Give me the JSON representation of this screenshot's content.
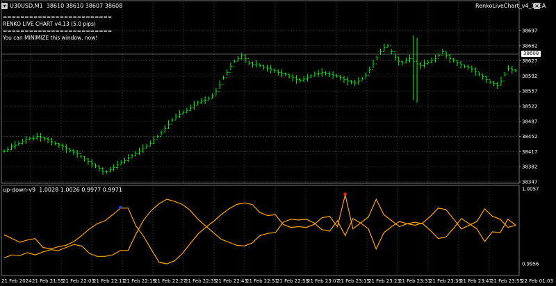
{
  "main_chart": {
    "title": "U30USD,M1  38610 38610 38607 38608",
    "indicator_name": "RenkoLiveChart_v4_13EA",
    "current_price": "38608",
    "renko_info": {
      "line1": "=========================",
      "line2": "RENKO LIVE CHART v4.13 (5.0 pips)",
      "line3": "=========================",
      "line4": "You can MINIMIZE this window, now!"
    },
    "price_ticks": [
      "38697",
      "38662",
      "38627",
      "38592",
      "38557",
      "38522",
      "38487",
      "38452",
      "38417",
      "38382",
      "38347"
    ],
    "colors": {
      "bars": "#00ff00",
      "grid": "#3c3c3c",
      "background": "#000000",
      "price_line": "#808080"
    }
  },
  "sub_chart": {
    "title": "up-down-v9  1.0028 1.0026 0.9977 0.9971",
    "ticks": [
      "1.0057",
      "0.9956"
    ],
    "colors": {
      "lines": "#ffa500",
      "dot_blue": "#2040ff",
      "dot_red": "#ff2020"
    }
  },
  "time_axis": [
    "21 Feb 2024",
    "21 Feb 21:55",
    "21 Feb 22:03",
    "21 Feb 22:11",
    "21 Feb 22:19",
    "21 Feb 22:27",
    "21 Feb 22:35",
    "21 Feb 22:43",
    "21 Feb 22:51",
    "21 Feb 22:59",
    "21 Feb 23:07",
    "21 Feb 23:15",
    "21 Feb 23:23",
    "21 Feb 23:31",
    "21 Feb 23:39",
    "21 Feb 23:47",
    "21 Feb 23:55",
    "22 Feb 01:03"
  ],
  "window_controls": {
    "menu_icon": "chevron-down-icon",
    "close_icon": "close-icon"
  },
  "chart_data": {
    "type": "line",
    "price_series": [
      38418,
      38422,
      38428,
      38432,
      38436,
      38440,
      38444,
      38447,
      38448,
      38452,
      38450,
      38447,
      38444,
      38440,
      38436,
      38432,
      38428,
      38424,
      38420,
      38416,
      38412,
      38406,
      38400,
      38394,
      38390,
      38384,
      38378,
      38372,
      38370,
      38375,
      38380,
      38386,
      38392,
      38396,
      38402,
      38408,
      38412,
      38418,
      38424,
      38430,
      38436,
      38444,
      38452,
      38460,
      38470,
      38480,
      38490,
      38498,
      38504,
      38508,
      38512,
      38518,
      38524,
      38530,
      38534,
      38536,
      38540,
      38546,
      38556,
      38572,
      38588,
      38600,
      38614,
      38626,
      38632,
      38638,
      38632,
      38622,
      38618,
      38620,
      38616,
      38612,
      38610,
      38608,
      38604,
      38600,
      38598,
      38596,
      38592,
      38588,
      38584,
      38582,
      38585,
      38588,
      38592,
      38596,
      38598,
      38600,
      38598,
      38596,
      38594,
      38592,
      38588,
      38584,
      38580,
      38578,
      38576,
      38580,
      38586,
      38594,
      38606,
      38620,
      38634,
      38648,
      38658,
      38662,
      38648,
      38636,
      38626,
      38622,
      38628,
      38632,
      38626,
      38620,
      38616,
      38620,
      38624,
      38628,
      38632,
      38640,
      38648,
      38640,
      38632,
      38628,
      38622,
      38618,
      38614,
      38612,
      38608,
      38602,
      38596,
      38590,
      38584,
      38578,
      38574,
      38570,
      38580,
      38596,
      38610,
      38606,
      38604
    ],
    "indicator_upper": [
      0.9995,
      0.999,
      0.9985,
      0.9988,
      0.999,
      0.9978,
      0.9976,
      0.9979,
      0.9981,
      0.9986,
      0.9994,
      1.0003,
      1.001,
      1.0014,
      1.0022,
      1.0031,
      1.0031,
      1.0007,
      0.9993,
      0.9975,
      0.9958,
      0.9956,
      0.996,
      0.997,
      0.9983,
      0.9996,
      1.0005,
      1.0013,
      1.0022,
      1.003,
      1.0036,
      1.0038,
      1.0036,
      1.0025,
      1.0021,
      1.0022,
      1.0009,
      1.0005,
      1.0006,
      1.0005,
      1.0009,
      1.0018,
      1.002,
      1.0006,
      1.0049,
      1.0003,
      1.0011,
      1.0019,
      1.0043,
      1.0022,
      1.0014,
      1.0006,
      1.001,
      1.0012,
      1.001,
      1.0001,
      0.999,
      0.9992,
      1.0004,
      1.0017,
      1.001,
      1.0003,
      0.9986,
      0.9999,
      0.9998,
      1.0016,
      1.0008
    ],
    "indicator_lower": [
      0.9964,
      0.9968,
      0.9967,
      0.9971,
      0.9968,
      0.9972,
      0.9975,
      0.9974,
      0.9978,
      0.9982,
      0.998,
      0.997,
      0.9966,
      0.9966,
      0.9968,
      0.9974,
      0.9974,
      0.9996,
      1.0015,
      1.0028,
      1.0037,
      1.0043,
      1.004,
      1.0036,
      1.0028,
      1.0016,
      1.0007,
      0.9998,
      0.9989,
      0.9985,
      0.9981,
      0.998,
      0.9984,
      0.9994,
      0.9997,
      0.9998,
      1.0012,
      1.0016,
      1.0015,
      1.0016,
      1.0011,
      1.0002,
      1.0,
      1.0014,
      0.9994,
      1.0017,
      1.0011,
      1.0003,
      0.9976,
      0.9998,
      1.0006,
      1.0013,
      1.001,
      1.0008,
      1.0011,
      1.002,
      1.0031,
      1.0029,
      1.0016,
      1.0003,
      1.0008,
      1.0013,
      1.003,
      1.002,
      1.0016,
      1.0005,
      1.0008
    ],
    "ylim_main": [
      38347,
      38697
    ],
    "ylim_sub": [
      0.9956,
      1.0057
    ],
    "grid": true
  }
}
